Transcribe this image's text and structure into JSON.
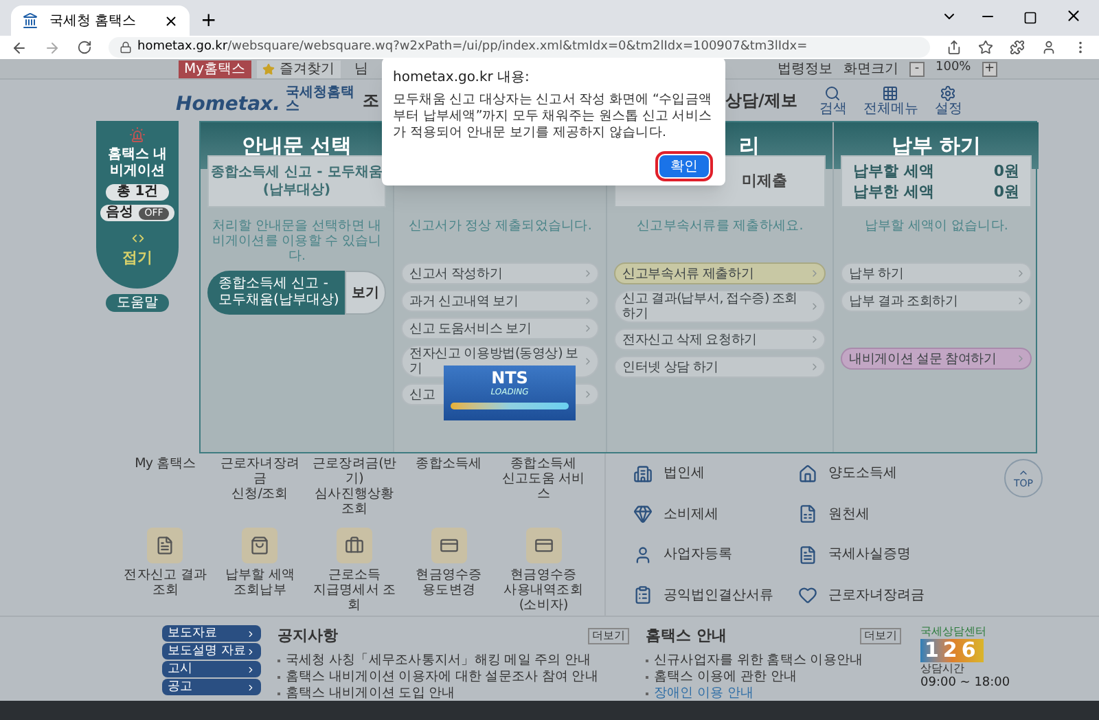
{
  "browser": {
    "tab_title": "국세청 홈택스",
    "new_tab": "+",
    "url_host": "hometax.go.kr",
    "url_path": "/websquare/websquare.wq?w2xPath=/ui/pp/index.xml&tmIdx=0&tm2lIdx=100907&tm3lIdx="
  },
  "util_bar": {
    "left": [
      {
        "label": "My홈택스",
        "kind": "red"
      },
      {
        "label": "즐겨찾기",
        "kind": "star"
      },
      {
        "label": "님",
        "kind": "plain"
      }
    ],
    "right": [
      "법령정보",
      "화면크기"
    ],
    "zoom": {
      "minus": "-",
      "value": "100%",
      "plus": "+"
    }
  },
  "header": {
    "logo": "Hometax.",
    "logo_sub": "국세청홈택스",
    "menu": [
      "조",
      "상담/제보"
    ],
    "tools": [
      {
        "label": "검색",
        "kind": "search"
      },
      {
        "label": "전체메뉴",
        "kind": "grid"
      },
      {
        "label": "설정",
        "kind": "gear"
      }
    ]
  },
  "navigator": {
    "title": "홈택스 내비게이션",
    "count": "총 1건",
    "voice_label": "음성",
    "voice_on": false,
    "voice_state": "OFF",
    "fold": "접기",
    "help": "도움말"
  },
  "columns": [
    {
      "kind": "select",
      "title": "안내문 선택",
      "box": "종합소득세 신고 - 모두채움\n(납부대상)",
      "hint": "처리할 안내문을 선택하면 내비게이션를 이용할 수 있습니다.",
      "notice": {
        "label": "종합소득세 신고 - 모두채움(납부대상)",
        "action": "보기"
      }
    },
    {
      "kind": "links",
      "hint": "신고서가 정상 제출되었습니다.",
      "links": [
        {
          "label": "신고서 작성하기",
          "kind": "normal"
        },
        {
          "label": "과거 신고내역 보기",
          "kind": "normal"
        },
        {
          "label": "신고 도움서비스 보기",
          "kind": "normal"
        },
        {
          "label": "전자신고 이용방법(동영상) 보기",
          "kind": "normal"
        },
        {
          "label": "신고",
          "kind": "normal"
        }
      ]
    },
    {
      "kind": "links",
      "title": "리",
      "box": "미제출",
      "hint": "신고부속서류를 제출하세요.",
      "links": [
        {
          "label": "신고부속서류 제출하기",
          "kind": "yellow"
        },
        {
          "label": "신고 결과(납부서, 접수증) 조회하기",
          "kind": "normal"
        },
        {
          "label": "전자신고 삭제 요청하기",
          "kind": "normal"
        },
        {
          "label": "인터넷 상담 하기",
          "kind": "normal"
        }
      ]
    },
    {
      "kind": "links",
      "title": "납부 하기",
      "amounts": [
        {
          "label": "납부할 세액",
          "value": "0원"
        },
        {
          "label": "납부한 세액",
          "value": "0원"
        }
      ],
      "hint": "납부할 세액이 없습니다.",
      "links": [
        {
          "label": "납부 하기",
          "kind": "normal"
        },
        {
          "label": "납부 결과 조회하기",
          "kind": "normal"
        },
        {
          "label": "내비게이션 설문 참여하기",
          "kind": "purple"
        }
      ]
    }
  ],
  "loader": {
    "title": "NTS",
    "subtitle": "LOADING"
  },
  "quick_top": [
    "My 홈택스",
    "근로자녀장려금\n신청/조회",
    "근로장려금(반기)\n심사진행상황 조회",
    "종합소득세",
    "종합소득세\n신고도움 서비스"
  ],
  "quick_bottom": [
    {
      "label": "전자신고 결과조회",
      "kind": "doc"
    },
    {
      "label": "납부할 세액\n조회납부",
      "kind": "bag"
    },
    {
      "label": "근로소득\n지급명세서 조회",
      "kind": "case"
    },
    {
      "label": "현금영수증\n용도변경",
      "kind": "card"
    },
    {
      "label": "현금영수증\n사용내역조회\n(소비자)",
      "kind": "card"
    }
  ],
  "tax_links": [
    {
      "label": "법인세",
      "kind": "building"
    },
    {
      "label": "양도소득세",
      "kind": "house"
    },
    {
      "label": "소비제세",
      "kind": "gem"
    },
    {
      "label": "원천세",
      "kind": "sheet"
    },
    {
      "label": "사업자등록",
      "kind": "user"
    },
    {
      "label": "국세사실증명",
      "kind": "doc"
    },
    {
      "label": "공익법인결산서류",
      "kind": "clipboard"
    },
    {
      "label": "근로자녀장려금",
      "kind": "heart"
    }
  ],
  "top_button": "TOP",
  "footer": {
    "side": [
      "보도자료",
      "보도설명 자료",
      "고시",
      "공고"
    ],
    "notice": {
      "title": "공지사항",
      "more": "더보기",
      "items": [
        {
          "text": "국세청 사칭「세무조사통지서」해킹 메일 주의 안내",
          "link": false
        },
        {
          "text": "홈택스 내비게이션 이용자에 대한 설문조사 참여 안내",
          "link": false
        },
        {
          "text": "홈택스 내비게이션 도입 안내",
          "link": false
        }
      ]
    },
    "guide": {
      "title": "홈택스 안내",
      "more": "더보기",
      "items": [
        {
          "text": "신규사업자를 위한 홈택스 이용안내",
          "link": false
        },
        {
          "text": "홈택스 이용에 관한 안내",
          "link": false
        },
        {
          "text": "장애인 이용 안내",
          "link": true
        }
      ]
    },
    "center": {
      "caption": "국세상담센터",
      "number": "126",
      "hours_label": "상담시간",
      "hours": "09:00 ~ 18:00"
    }
  },
  "dialog": {
    "title": "hometax.go.kr 내용:",
    "message": "모두채움 신고 대상자는 신고서 작성 화면에 “수입금액부터 납부세액”까지 모두 채워주는 원스톱 신고 서비스가 적용되어 안내문 보기를 제공하지 않습니다.",
    "ok": "확인",
    "highlighted": true
  }
}
